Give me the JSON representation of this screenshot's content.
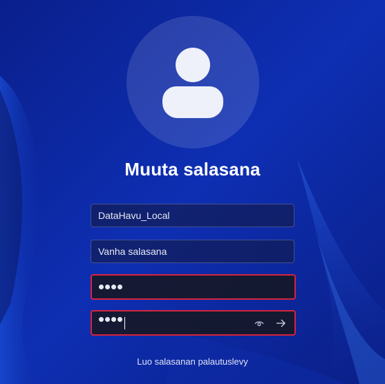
{
  "page": {
    "title": "Muuta salasana"
  },
  "fields": {
    "username": {
      "value": "DataHavu_Local"
    },
    "old_password": {
      "placeholder": "Vanha salasana"
    },
    "new_password": {
      "masked_length": 4,
      "error": true
    },
    "confirm_password": {
      "masked_length": 4,
      "error": true,
      "focused": true
    }
  },
  "links": {
    "reset_disk": "Luo salasanan palautuslevy"
  },
  "colors": {
    "accent": "#0b2aa6",
    "error_border": "#d8233a",
    "text": "#ffffff"
  },
  "icons": [
    "user-avatar-icon",
    "eye-icon",
    "arrow-right-icon"
  ]
}
